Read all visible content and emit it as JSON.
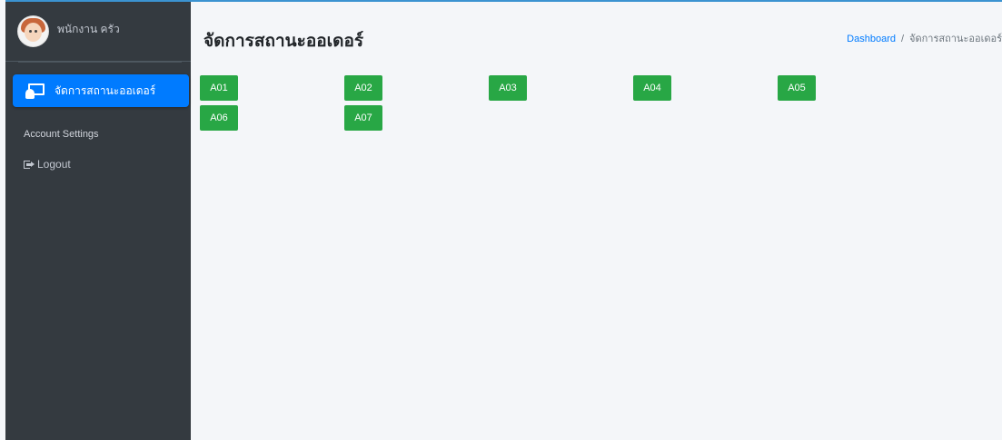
{
  "user": {
    "name": "พนักงาน ครัว",
    "avatar": "avatar-icon"
  },
  "sidebar": {
    "active_item": {
      "label": "จัดการสถานะออเดอร์",
      "icon": "chalkboard-teacher-icon"
    },
    "section_header": "Account Settings",
    "logout": {
      "label": "Logout",
      "icon": "sign-out-icon"
    }
  },
  "header": {
    "title": "จัดการสถานะออเดอร์",
    "breadcrumb": {
      "home": "Dashboard",
      "separator": "/",
      "current": "จัดการสถานะออเดอร์"
    }
  },
  "tables": [
    "A01",
    "A02",
    "A03",
    "A04",
    "A05",
    "A06",
    "A07"
  ],
  "colors": {
    "sidebar_bg": "#343a40",
    "active_nav": "#007bff",
    "table_button": "#28a745",
    "content_bg": "#f4f6f9",
    "link": "#007bff"
  }
}
